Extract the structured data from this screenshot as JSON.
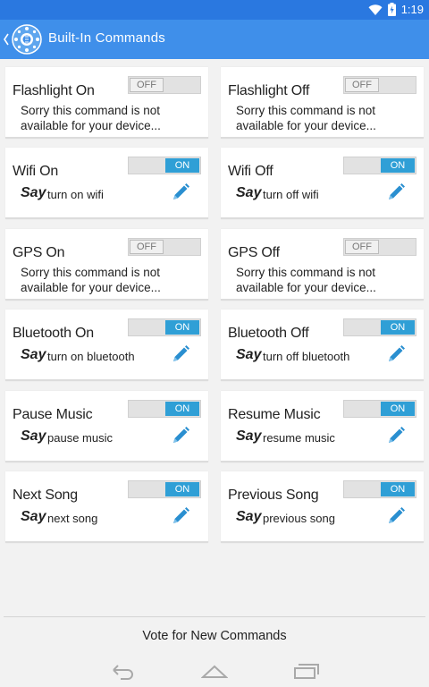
{
  "status": {
    "time": "1:19"
  },
  "app": {
    "title": "Built-In Commands"
  },
  "commands": [
    {
      "title": "Flashlight On",
      "state": "OFF",
      "message": "Sorry this command is not available for your device..."
    },
    {
      "title": "Flashlight Off",
      "state": "OFF",
      "message": "Sorry this command is not available for your device..."
    },
    {
      "title": "Wifi On",
      "state": "ON",
      "say": "Say",
      "phrase": "turn on wifi"
    },
    {
      "title": "Wifi Off",
      "state": "ON",
      "say": "Say",
      "phrase": "turn off wifi"
    },
    {
      "title": "GPS On",
      "state": "OFF",
      "message": "Sorry this command is not available for your device..."
    },
    {
      "title": "GPS Off",
      "state": "OFF",
      "message": "Sorry this command is not available for your device..."
    },
    {
      "title": "Bluetooth On",
      "state": "ON",
      "say": "Say",
      "phrase": "turn on bluetooth"
    },
    {
      "title": "Bluetooth Off",
      "state": "ON",
      "say": "Say",
      "phrase": "turn off bluetooth"
    },
    {
      "title": "Pause Music",
      "state": "ON",
      "say": "Say",
      "phrase": "pause music"
    },
    {
      "title": "Resume Music",
      "state": "ON",
      "say": "Say",
      "phrase": "resume music"
    },
    {
      "title": "Next Song",
      "state": "ON",
      "say": "Say",
      "phrase": "next song"
    },
    {
      "title": "Previous Song",
      "state": "ON",
      "say": "Say",
      "phrase": "previous song"
    }
  ],
  "footer": {
    "vote_label": "Vote for New Commands"
  },
  "colors": {
    "statusbar": "#2a78e0",
    "actionbar": "#3f8fea",
    "toggle_on": "#2f9fd6",
    "edit_icon": "#2a8fd0"
  },
  "icons": {
    "edit": "pencil-icon",
    "back": "back-icon",
    "home": "home-icon",
    "recents": "recents-icon"
  }
}
